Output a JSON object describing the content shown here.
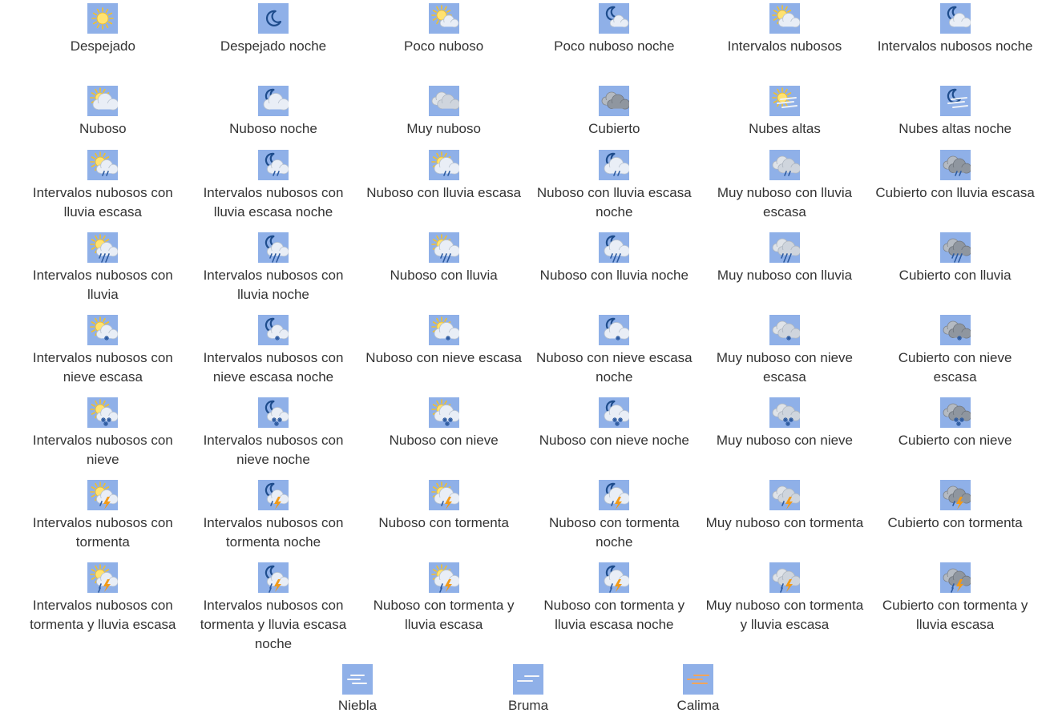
{
  "colors": {
    "tile": "#8fb0e8",
    "calima_tile": "#8fb0e8",
    "sun": "#ffe270",
    "sun_rays": "#f2c02c",
    "moon": "#1e4c8c",
    "cloud_light": "#e9eef6",
    "cloud_mid": "#cfd5dd",
    "cloud_dark": "#8f969f",
    "rain": "#2c5aa0",
    "bolt": "#f29a18",
    "haze": "#f1a45a"
  },
  "grid_rows": [
    [
      {
        "name": "despejado",
        "label": "Despejado",
        "icon": "sun-icon",
        "sky": "sun",
        "cloud": "none",
        "precip": "none"
      },
      {
        "name": "despejado-noche",
        "label": "Despejado noche",
        "icon": "moon-icon",
        "sky": "moon",
        "cloud": "none",
        "precip": "none"
      },
      {
        "name": "poco-nuboso",
        "label": "Poco nuboso",
        "icon": "sun-small-cloud-icon",
        "sky": "sun",
        "cloud": "small",
        "precip": "none"
      },
      {
        "name": "poco-nuboso-noche",
        "label": "Poco nuboso noche",
        "icon": "moon-small-cloud-icon",
        "sky": "moon",
        "cloud": "small",
        "precip": "none"
      },
      {
        "name": "intervalos-nubosos",
        "label": "Intervalos nubosos",
        "icon": "sun-cloud-icon",
        "sky": "sun",
        "cloud": "light",
        "precip": "none"
      },
      {
        "name": "intervalos-nubosos-noche",
        "label": "Intervalos nubosos noche",
        "icon": "moon-cloud-icon",
        "sky": "moon",
        "cloud": "light",
        "precip": "none"
      }
    ],
    [
      {
        "name": "nuboso",
        "label": "Nuboso",
        "icon": "sun-cloud-icon",
        "sky": "sun",
        "cloud": "big",
        "precip": "none"
      },
      {
        "name": "nuboso-noche",
        "label": "Nuboso noche",
        "icon": "moon-cloud-icon",
        "sky": "moon",
        "cloud": "big",
        "precip": "none"
      },
      {
        "name": "muy-nuboso",
        "label": "Muy nuboso",
        "icon": "clouds-icon",
        "sky": "none",
        "cloud": "double-light",
        "precip": "none"
      },
      {
        "name": "cubierto",
        "label": "Cubierto",
        "icon": "dark-clouds-icon",
        "sky": "none",
        "cloud": "double-dark",
        "precip": "none"
      },
      {
        "name": "nubes-altas",
        "label": "Nubes altas",
        "icon": "sun-high-clouds-icon",
        "sky": "sun",
        "cloud": "streaks",
        "precip": "none"
      },
      {
        "name": "nubes-altas-noche",
        "label": "Nubes altas noche",
        "icon": "moon-high-clouds-icon",
        "sky": "moon",
        "cloud": "streaks",
        "precip": "none"
      }
    ],
    [
      {
        "name": "intervalos-nubosos-lluvia-escasa",
        "label": "Intervalos nubosos con lluvia escasa",
        "icon": "sun-cloud-light-rain-icon",
        "sky": "sun",
        "cloud": "light",
        "precip": "light-rain"
      },
      {
        "name": "intervalos-nubosos-lluvia-escasa-noche",
        "label": "Intervalos nubosos con lluvia escasa noche",
        "icon": "moon-cloud-light-rain-icon",
        "sky": "moon",
        "cloud": "light",
        "precip": "light-rain"
      },
      {
        "name": "nuboso-lluvia-escasa",
        "label": "Nuboso con lluvia escasa",
        "icon": "sun-cloud-light-rain-icon",
        "sky": "sun",
        "cloud": "big",
        "precip": "light-rain"
      },
      {
        "name": "nuboso-lluvia-escasa-noche",
        "label": "Nuboso con lluvia escasa noche",
        "icon": "moon-cloud-light-rain-icon",
        "sky": "moon",
        "cloud": "big",
        "precip": "light-rain"
      },
      {
        "name": "muy-nuboso-lluvia-escasa",
        "label": "Muy nuboso con lluvia escasa",
        "icon": "clouds-light-rain-icon",
        "sky": "none",
        "cloud": "double-light",
        "precip": "light-rain"
      },
      {
        "name": "cubierto-lluvia-escasa",
        "label": "Cubierto con lluvia escasa",
        "icon": "dark-clouds-light-rain-icon",
        "sky": "none",
        "cloud": "double-dark",
        "precip": "light-rain"
      }
    ],
    [
      {
        "name": "intervalos-nubosos-lluvia",
        "label": "Intervalos nubosos con lluvia",
        "icon": "sun-cloud-rain-icon",
        "sky": "sun",
        "cloud": "light",
        "precip": "rain"
      },
      {
        "name": "intervalos-nubosos-lluvia-noche",
        "label": "Intervalos nubosos con lluvia noche",
        "icon": "moon-cloud-rain-icon",
        "sky": "moon",
        "cloud": "light",
        "precip": "rain"
      },
      {
        "name": "nuboso-lluvia",
        "label": "Nuboso con lluvia",
        "icon": "sun-cloud-rain-icon",
        "sky": "sun",
        "cloud": "big",
        "precip": "rain"
      },
      {
        "name": "nuboso-lluvia-noche",
        "label": "Nuboso con lluvia noche",
        "icon": "moon-cloud-rain-icon",
        "sky": "moon",
        "cloud": "big",
        "precip": "rain"
      },
      {
        "name": "muy-nuboso-lluvia",
        "label": "Muy nuboso con lluvia",
        "icon": "clouds-rain-icon",
        "sky": "none",
        "cloud": "double-light",
        "precip": "rain"
      },
      {
        "name": "cubierto-lluvia",
        "label": "Cubierto con lluvia",
        "icon": "dark-clouds-rain-icon",
        "sky": "none",
        "cloud": "double-dark",
        "precip": "rain"
      }
    ],
    [
      {
        "name": "intervalos-nubosos-nieve-escasa",
        "label": "Intervalos nubosos con nieve escasa",
        "icon": "sun-cloud-light-snow-icon",
        "sky": "sun",
        "cloud": "light",
        "precip": "light-snow"
      },
      {
        "name": "intervalos-nubosos-nieve-escasa-noche",
        "label": "Intervalos nubosos con nieve escasa noche",
        "icon": "moon-cloud-light-snow-icon",
        "sky": "moon",
        "cloud": "light",
        "precip": "light-snow"
      },
      {
        "name": "nuboso-nieve-escasa",
        "label": "Nuboso con nieve escasa",
        "icon": "sun-cloud-light-snow-icon",
        "sky": "sun",
        "cloud": "big",
        "precip": "light-snow"
      },
      {
        "name": "nuboso-nieve-escasa-noche",
        "label": "Nuboso con nieve escasa noche",
        "icon": "moon-cloud-light-snow-icon",
        "sky": "moon",
        "cloud": "big",
        "precip": "light-snow"
      },
      {
        "name": "muy-nuboso-nieve-escasa",
        "label": "Muy nuboso con nieve escasa",
        "icon": "clouds-light-snow-icon",
        "sky": "none",
        "cloud": "double-light",
        "precip": "light-snow"
      },
      {
        "name": "cubierto-nieve-escasa",
        "label": "Cubierto con nieve escasa",
        "icon": "dark-clouds-light-snow-icon",
        "sky": "none",
        "cloud": "double-dark",
        "precip": "light-snow"
      }
    ],
    [
      {
        "name": "intervalos-nubosos-nieve",
        "label": "Intervalos nubosos con nieve",
        "icon": "sun-cloud-snow-icon",
        "sky": "sun",
        "cloud": "light",
        "precip": "snow"
      },
      {
        "name": "intervalos-nubosos-nieve-noche",
        "label": "Intervalos nubosos con nieve noche",
        "icon": "moon-cloud-snow-icon",
        "sky": "moon",
        "cloud": "light",
        "precip": "snow"
      },
      {
        "name": "nuboso-nieve",
        "label": "Nuboso con nieve",
        "icon": "sun-cloud-snow-icon",
        "sky": "sun",
        "cloud": "big",
        "precip": "snow"
      },
      {
        "name": "nuboso-nieve-noche",
        "label": "Nuboso con nieve noche",
        "icon": "moon-cloud-snow-icon",
        "sky": "moon",
        "cloud": "big",
        "precip": "snow"
      },
      {
        "name": "muy-nuboso-nieve",
        "label": "Muy nuboso con nieve",
        "icon": "clouds-snow-icon",
        "sky": "none",
        "cloud": "double-light",
        "precip": "snow"
      },
      {
        "name": "cubierto-nieve",
        "label": "Cubierto con nieve",
        "icon": "dark-clouds-snow-icon",
        "sky": "none",
        "cloud": "double-dark",
        "precip": "snow"
      }
    ],
    [
      {
        "name": "intervalos-nubosos-tormenta",
        "label": "Intervalos nubosos con tormenta",
        "icon": "sun-cloud-storm-icon",
        "sky": "sun",
        "cloud": "light",
        "precip": "storm"
      },
      {
        "name": "intervalos-nubosos-tormenta-noche",
        "label": "Intervalos nubosos con tormenta noche",
        "icon": "moon-cloud-storm-icon",
        "sky": "moon",
        "cloud": "light",
        "precip": "storm"
      },
      {
        "name": "nuboso-tormenta",
        "label": "Nuboso con tormenta",
        "icon": "sun-cloud-storm-icon",
        "sky": "sun",
        "cloud": "big",
        "precip": "storm"
      },
      {
        "name": "nuboso-tormenta-noche",
        "label": "Nuboso con tormenta noche",
        "icon": "moon-cloud-storm-icon",
        "sky": "moon",
        "cloud": "big",
        "precip": "storm"
      },
      {
        "name": "muy-nuboso-tormenta",
        "label": "Muy nuboso con tormenta",
        "icon": "clouds-storm-icon",
        "sky": "none",
        "cloud": "double-light",
        "precip": "storm"
      },
      {
        "name": "cubierto-tormenta",
        "label": "Cubierto con tormenta",
        "icon": "dark-clouds-storm-icon",
        "sky": "none",
        "cloud": "double-dark",
        "precip": "storm"
      }
    ],
    [
      {
        "name": "intervalos-nubosos-tormenta-lluvia-escasa",
        "label": "Intervalos nubosos con tormenta y lluvia escasa",
        "icon": "sun-cloud-storm-rain-icon",
        "sky": "sun",
        "cloud": "light",
        "precip": "storm-rain"
      },
      {
        "name": "intervalos-nubosos-tormenta-lluvia-escasa-noche",
        "label": "Intervalos nubosos con tormenta y lluvia escasa noche",
        "icon": "moon-cloud-storm-rain-icon",
        "sky": "moon",
        "cloud": "light",
        "precip": "storm-rain"
      },
      {
        "name": "nuboso-tormenta-lluvia-escasa",
        "label": "Nuboso con tormenta y lluvia escasa",
        "icon": "sun-cloud-storm-rain-icon",
        "sky": "sun",
        "cloud": "big",
        "precip": "storm-rain"
      },
      {
        "name": "nuboso-tormenta-lluvia-escasa-noche",
        "label": "Nuboso con tormenta y lluvia escasa noche",
        "icon": "moon-cloud-storm-rain-icon",
        "sky": "moon",
        "cloud": "big",
        "precip": "storm-rain"
      },
      {
        "name": "muy-nuboso-tormenta-lluvia-escasa",
        "label": "Muy nuboso con tormenta y lluvia escasa",
        "icon": "clouds-storm-rain-icon",
        "sky": "none",
        "cloud": "double-light",
        "precip": "storm-rain"
      },
      {
        "name": "cubierto-tormenta-lluvia-escasa",
        "label": "Cubierto con tormenta y lluvia escasa",
        "icon": "dark-clouds-storm-rain-icon",
        "sky": "none",
        "cloud": "double-dark",
        "precip": "storm-rain"
      }
    ]
  ],
  "bottom_row": [
    {
      "name": "niebla",
      "label": "Niebla",
      "icon": "fog-icon",
      "style": "fog"
    },
    {
      "name": "bruma",
      "label": "Bruma",
      "icon": "mist-icon",
      "style": "mist"
    },
    {
      "name": "calima",
      "label": "Calima",
      "icon": "haze-icon",
      "style": "haze"
    }
  ]
}
